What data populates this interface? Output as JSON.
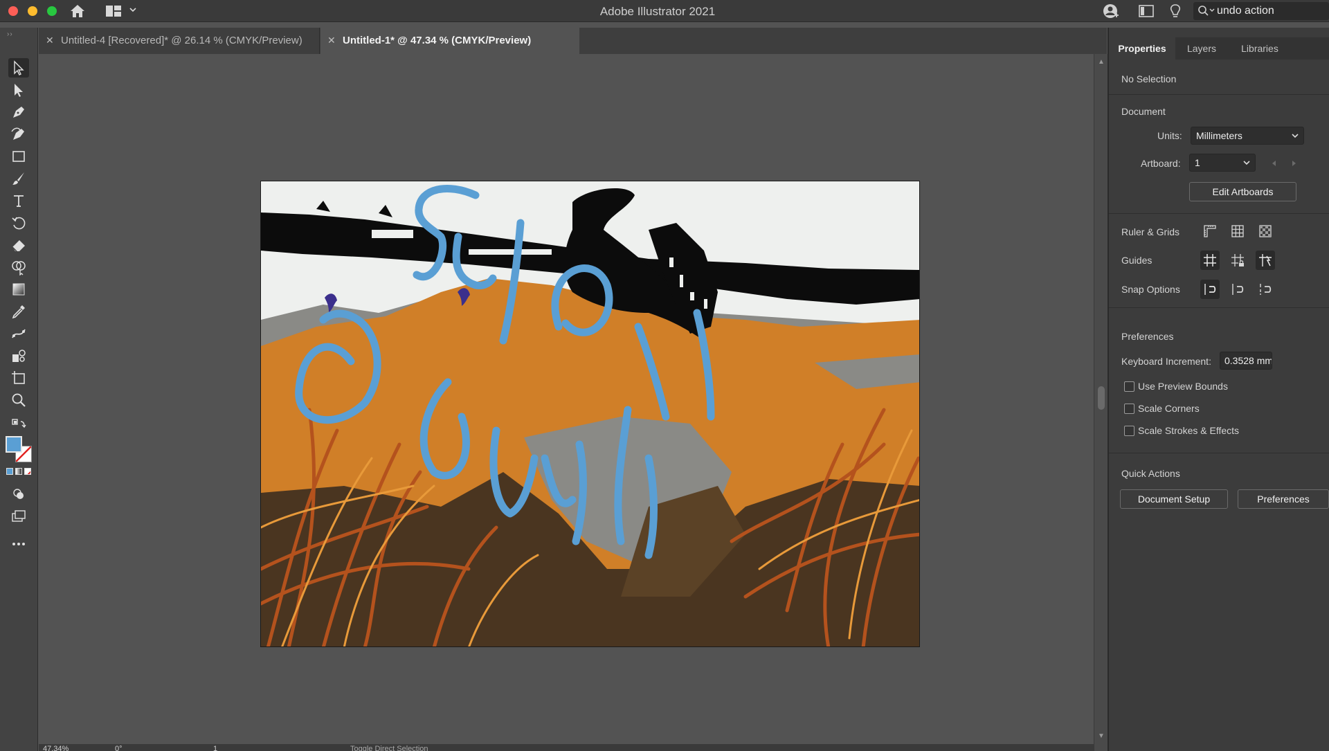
{
  "app": {
    "title": "Adobe Illustrator 2021"
  },
  "search": {
    "value": "undo action"
  },
  "tabs": [
    {
      "label": "Untitled-4 [Recovered]* @ 26.14 % (CMYK/Preview)",
      "active": false
    },
    {
      "label": "Untitled-1* @ 47.34 % (CMYK/Preview)",
      "active": true
    }
  ],
  "tools": [
    "selection-tool",
    "direct-selection-tool",
    "pen-tool",
    "curvature-tool",
    "rectangle-tool",
    "paintbrush-tool",
    "type-tool",
    "rotate-tool",
    "eraser-tool",
    "shape-builder-tool",
    "gradient-tool",
    "eyedropper-tool",
    "blend-tool",
    "symbol-sprayer-tool",
    "artboard-tool",
    "zoom-tool"
  ],
  "fill_stroke": {
    "fill_color": "#5a9fd4",
    "stroke_color": "none"
  },
  "panel": {
    "tabs": [
      "Properties",
      "Layers",
      "Libraries"
    ],
    "selection_status": "No Selection",
    "document": {
      "heading": "Document",
      "units_label": "Units:",
      "units_value": "Millimeters",
      "artboard_label": "Artboard:",
      "artboard_value": "1",
      "edit_artboards": "Edit Artboards"
    },
    "ruler_grids": "Ruler & Grids",
    "guides": "Guides",
    "snap_options": "Snap Options",
    "preferences": {
      "heading": "Preferences",
      "kb_label": "Keyboard Increment:",
      "kb_value": "0.3528 mm",
      "checkboxes": [
        {
          "label": "Use Preview Bounds",
          "checked": false
        },
        {
          "label": "Scale Corners",
          "checked": false
        },
        {
          "label": "Scale Strokes & Effects",
          "checked": false
        }
      ]
    },
    "quick_actions": {
      "heading": "Quick Actions",
      "document_setup": "Document Setup",
      "preferences": "Preferences"
    }
  },
  "status": {
    "zoom": "47.34%",
    "rotation": "0°",
    "artboard": "1",
    "tool_hint": "Toggle Direct Selection"
  },
  "artwork": {
    "lettering": {
      "slow": "SLOW",
      "down": "DOWN",
      "arafwch": "ARAFWCH"
    },
    "colors": {
      "lettering": "#5a9fd4",
      "sky": "#eef0ee",
      "orange": "#d07f28",
      "rust": "#b4521d",
      "dark_brown": "#4a3520",
      "grey": "#8a8a86",
      "black": "#0c0c0c",
      "bird": "#3b2f8c"
    }
  }
}
